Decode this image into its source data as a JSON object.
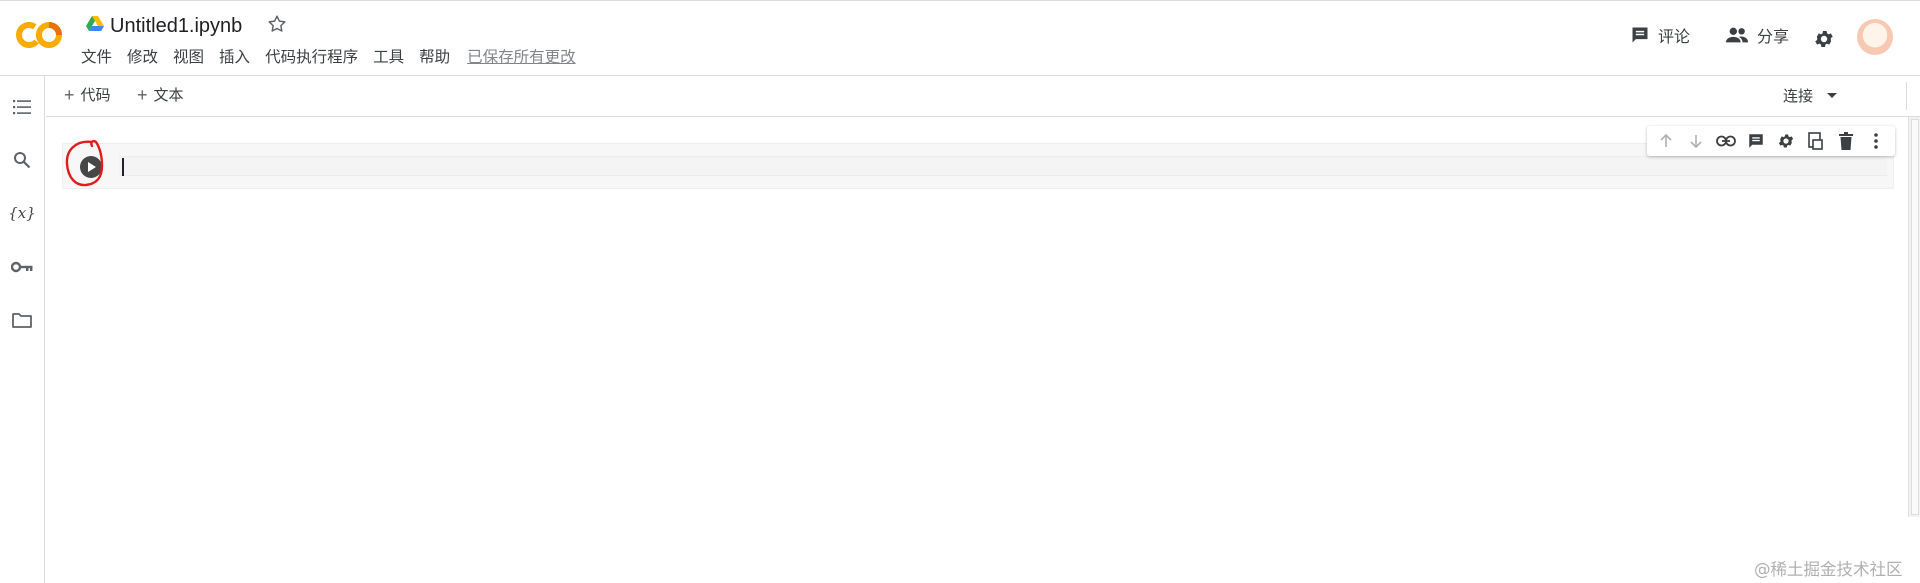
{
  "app": {
    "logo_text": "CO",
    "notebook_title": "Untitled1.ipynb"
  },
  "menu": {
    "items": [
      "文件",
      "修改",
      "视图",
      "插入",
      "代码执行程序",
      "工具",
      "帮助"
    ],
    "saved_status": "已保存所有更改"
  },
  "header_actions": {
    "comment_label": "评论",
    "share_label": "分享"
  },
  "toolbar": {
    "add_code_label": "代码",
    "add_text_label": "文本",
    "connect_label": "连接"
  },
  "sidebar": {
    "variables_label": "{x}"
  },
  "cell": {
    "code": ""
  },
  "watermark": "@稀土掘金技术社区",
  "colors": {
    "logo_orange": "#F9AB00",
    "logo_dark_orange": "#E8710A",
    "annotation_red": "#E31B1B",
    "run_button": "#474747"
  },
  "icons": [
    "drive-icon",
    "star-icon",
    "comment-icon",
    "people-icon",
    "gear-icon",
    "toc-icon",
    "search-icon",
    "variables-icon",
    "key-icon",
    "folder-icon",
    "arrow-up-icon",
    "arrow-down-icon",
    "link-icon",
    "comment-icon",
    "gear-icon",
    "mirror-cell-icon",
    "delete-icon",
    "more-vert-icon",
    "chevron-up-icon",
    "play-icon"
  ]
}
